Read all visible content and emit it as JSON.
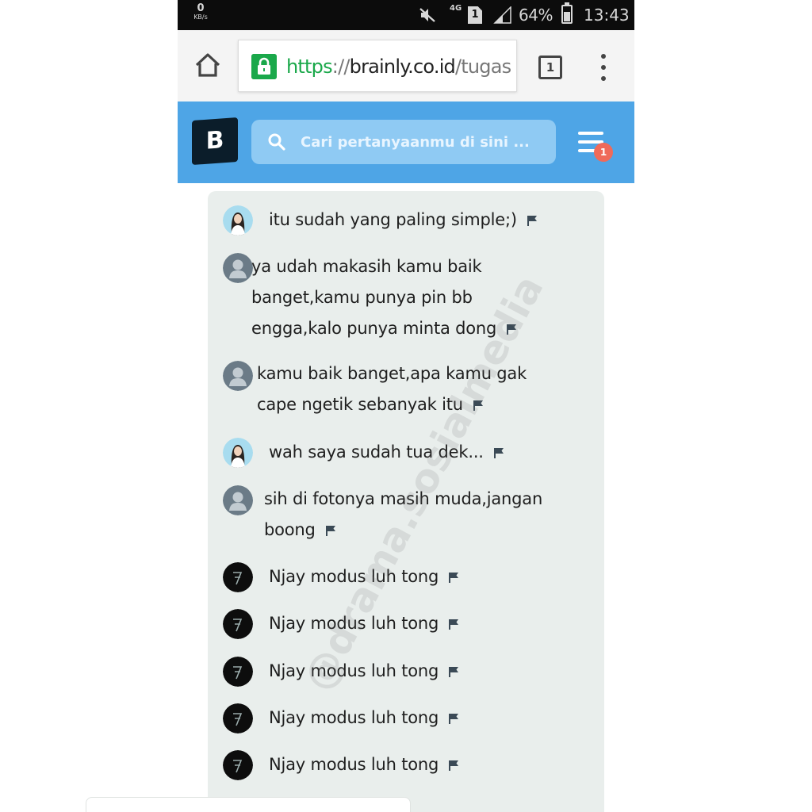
{
  "status_bar": {
    "net_speed_value": "0",
    "net_speed_unit": "KB/s",
    "network_type": "4G",
    "sim_slot": "1",
    "battery_percent": "64%",
    "time": "13:43",
    "icons": [
      "mute-icon",
      "sim-icon",
      "signal-icon",
      "battery-icon"
    ]
  },
  "browser": {
    "url_scheme": "https",
    "url_sep": "://",
    "url_domain": "brainly.co.id",
    "url_path": "/tugas",
    "tab_count": "1",
    "accent_color": "#1aa84a"
  },
  "app_header": {
    "logo_letter": "B",
    "search_placeholder": "Cari pertanyaanmu di sini ...",
    "notification_count": "1",
    "header_color": "#4ea5e6"
  },
  "chat": {
    "messages": [
      {
        "avatar": "woman",
        "text": "itu sudah yang paling simple;)"
      },
      {
        "avatar": "default",
        "text": "ya udah makasih kamu baik banget,kamu punya pin bb engga,kalo punya minta dong"
      },
      {
        "avatar": "default",
        "text": "kamu baik banget,apa kamu gak cape ngetik sebanyak itu"
      },
      {
        "avatar": "woman",
        "text": "wah saya sudah tua dek..."
      },
      {
        "avatar": "default",
        "text": "sih di fotonya masih muda,jangan boong"
      },
      {
        "avatar": "dark",
        "text": "Njay modus luh tong"
      },
      {
        "avatar": "dark",
        "text": "Njay modus luh tong"
      },
      {
        "avatar": "dark",
        "text": "Njay modus luh tong"
      },
      {
        "avatar": "dark",
        "text": "Njay modus luh tong"
      },
      {
        "avatar": "dark",
        "text": "Njay modus luh tong"
      }
    ]
  },
  "watermark": "@drama.sosialmedia"
}
